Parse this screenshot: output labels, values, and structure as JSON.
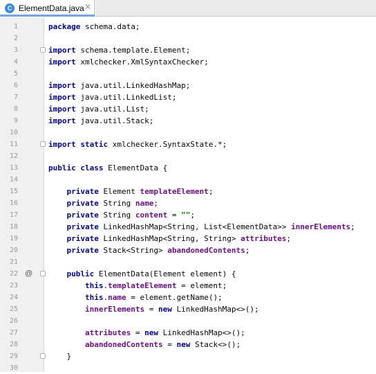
{
  "tab": {
    "filename": "ElementData.java",
    "icon_letter": "C",
    "close": "✕"
  },
  "gutter": {
    "annotation_line": "22",
    "annotation_symbol": "@"
  },
  "lines": [
    {
      "n": "1",
      "t": [
        [
          "k",
          "package"
        ],
        [
          "",
          "schema.data;"
        ]
      ]
    },
    {
      "n": "2",
      "t": []
    },
    {
      "n": "3",
      "t": [
        [
          "k",
          "import"
        ],
        [
          "",
          "schema.template.Element;"
        ]
      ],
      "fold": true
    },
    {
      "n": "4",
      "t": [
        [
          "k",
          "import"
        ],
        [
          "",
          "xmlchecker.XmlSyntaxChecker;"
        ]
      ]
    },
    {
      "n": "5",
      "t": []
    },
    {
      "n": "6",
      "t": [
        [
          "k",
          "import"
        ],
        [
          "",
          "java.util.LinkedHashMap;"
        ]
      ]
    },
    {
      "n": "7",
      "t": [
        [
          "k",
          "import"
        ],
        [
          "",
          "java.util.LinkedList;"
        ]
      ]
    },
    {
      "n": "8",
      "t": [
        [
          "k",
          "import"
        ],
        [
          "",
          "java.util.List;"
        ]
      ]
    },
    {
      "n": "9",
      "t": [
        [
          "k",
          "import"
        ],
        [
          "",
          "java.util.Stack;"
        ]
      ]
    },
    {
      "n": "10",
      "t": []
    },
    {
      "n": "11",
      "t": [
        [
          "k",
          "import static"
        ],
        [
          "",
          "xmlchecker.SyntaxState.*;"
        ]
      ],
      "fold": true
    },
    {
      "n": "12",
      "t": []
    },
    {
      "n": "13",
      "t": [
        [
          "k",
          "public class"
        ],
        [
          "",
          "ElementData {"
        ]
      ]
    },
    {
      "n": "14",
      "t": []
    },
    {
      "n": "15",
      "t": [
        [
          "k",
          "    private"
        ],
        [
          "",
          "Element"
        ],
        [
          "f",
          "templateElement"
        ],
        [
          "",
          ";"
        ]
      ]
    },
    {
      "n": "16",
      "t": [
        [
          "k",
          "    private"
        ],
        [
          "",
          "String"
        ],
        [
          "f",
          "name"
        ],
        [
          "",
          ";"
        ]
      ]
    },
    {
      "n": "17",
      "t": [
        [
          "k",
          "    private"
        ],
        [
          "",
          "String"
        ],
        [
          "f",
          "content"
        ],
        [
          "",
          "="
        ],
        [
          "s",
          "\"\""
        ],
        [
          "",
          ";"
        ]
      ]
    },
    {
      "n": "18",
      "t": [
        [
          "k",
          "    private"
        ],
        [
          "",
          "LinkedHashMap<String, List<ElementData>>"
        ],
        [
          "f",
          "innerElements"
        ],
        [
          "",
          ";"
        ]
      ]
    },
    {
      "n": "19",
      "t": [
        [
          "k",
          "    private"
        ],
        [
          "",
          "LinkedHashMap<String, String>"
        ],
        [
          "f",
          "attributes"
        ],
        [
          "",
          ";"
        ]
      ]
    },
    {
      "n": "20",
      "t": [
        [
          "k",
          "    private"
        ],
        [
          "",
          "Stack<String>"
        ],
        [
          "f",
          "abandonedContents"
        ],
        [
          "",
          ";"
        ]
      ]
    },
    {
      "n": "21",
      "t": []
    },
    {
      "n": "22",
      "t": [
        [
          "k",
          "    public"
        ],
        [
          "",
          "ElementData(Element element) {"
        ]
      ],
      "fold": true
    },
    {
      "n": "23",
      "t": [
        [
          "k",
          "        this"
        ],
        [
          "",
          "."
        ],
        [
          "f",
          "templateElement"
        ],
        [
          "",
          "= element;"
        ]
      ]
    },
    {
      "n": "24",
      "t": [
        [
          "k",
          "        this"
        ],
        [
          "",
          "."
        ],
        [
          "f",
          "name"
        ],
        [
          "",
          "= element.getName();"
        ]
      ]
    },
    {
      "n": "25",
      "t": [
        [
          "f",
          "        innerElements"
        ],
        [
          "",
          "="
        ],
        [
          "k",
          "new"
        ],
        [
          "",
          "LinkedHashMap<>();"
        ]
      ]
    },
    {
      "n": "26",
      "t": []
    },
    {
      "n": "27",
      "t": [
        [
          "f",
          "        attributes"
        ],
        [
          "",
          "="
        ],
        [
          "k",
          "new"
        ],
        [
          "",
          "LinkedHashMap<>();"
        ]
      ]
    },
    {
      "n": "28",
      "t": [
        [
          "f",
          "        abandonedContents"
        ],
        [
          "",
          "="
        ],
        [
          "k",
          "new"
        ],
        [
          "",
          "Stack<>();"
        ]
      ]
    },
    {
      "n": "29",
      "t": [
        [
          "",
          "    }"
        ]
      ],
      "fold": true
    },
    {
      "n": "30",
      "t": []
    }
  ]
}
